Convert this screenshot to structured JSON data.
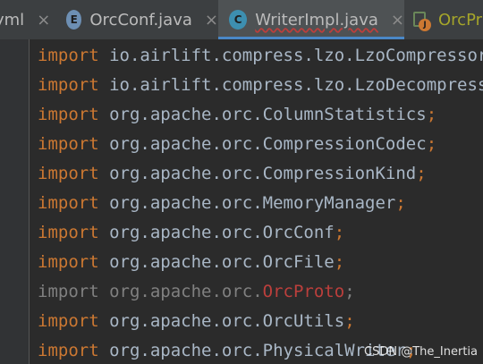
{
  "tabs": [
    {
      "label": "yml",
      "close": "×",
      "icon": "yaml-file-icon",
      "active": false
    },
    {
      "label": "OrcConf.java",
      "close": "×",
      "icon": "enum-file-icon",
      "icon_letter": "E",
      "active": false
    },
    {
      "label": "WriterImpl.java",
      "close": "×",
      "icon": "class-file-icon",
      "icon_letter": "C",
      "active": true
    },
    {
      "label": "OrcPr",
      "icon": "java-file-icon",
      "icon_letter": "J",
      "active": false
    }
  ],
  "code_lines": [
    {
      "keyword": "import",
      "package": " io.airlift.compress.lzo.LzoCompressor",
      "semicolon": ";"
    },
    {
      "keyword": "import",
      "package": " io.airlift.compress.lzo.LzoDecompressor",
      "semicolon": ";"
    },
    {
      "keyword": "import",
      "package": " org.apache.orc.ColumnStatistics",
      "semicolon": ";"
    },
    {
      "keyword": "import",
      "package": " org.apache.orc.CompressionCodec",
      "semicolon": ";"
    },
    {
      "keyword": "import",
      "package": " org.apache.orc.CompressionKind",
      "semicolon": ";"
    },
    {
      "keyword": "import",
      "package": " org.apache.orc.MemoryManager",
      "semicolon": ";"
    },
    {
      "keyword": "import",
      "package": " org.apache.orc.OrcConf",
      "semicolon": ";"
    },
    {
      "keyword": "import",
      "package": " org.apache.orc.OrcFile",
      "semicolon": ";"
    },
    {
      "keyword": "import",
      "package": " org.apache.orc.",
      "error_class": "OrcProto",
      "semicolon": ";",
      "unused": true
    },
    {
      "keyword": "import",
      "package": " org.apache.orc.OrcUtils",
      "semicolon": ";"
    },
    {
      "keyword": "import",
      "package": " org.apache.orc.PhysicalWriter",
      "semicolon": ";"
    }
  ],
  "colors": {
    "background": "#2b2b2b",
    "keyword": "#cc7832",
    "identifier": "#a9b7c6",
    "unused": "#808080",
    "error": "#bc3f3c",
    "active_tab_underline": "#4a88c7"
  },
  "watermark": "CSDN @The_Inertia"
}
